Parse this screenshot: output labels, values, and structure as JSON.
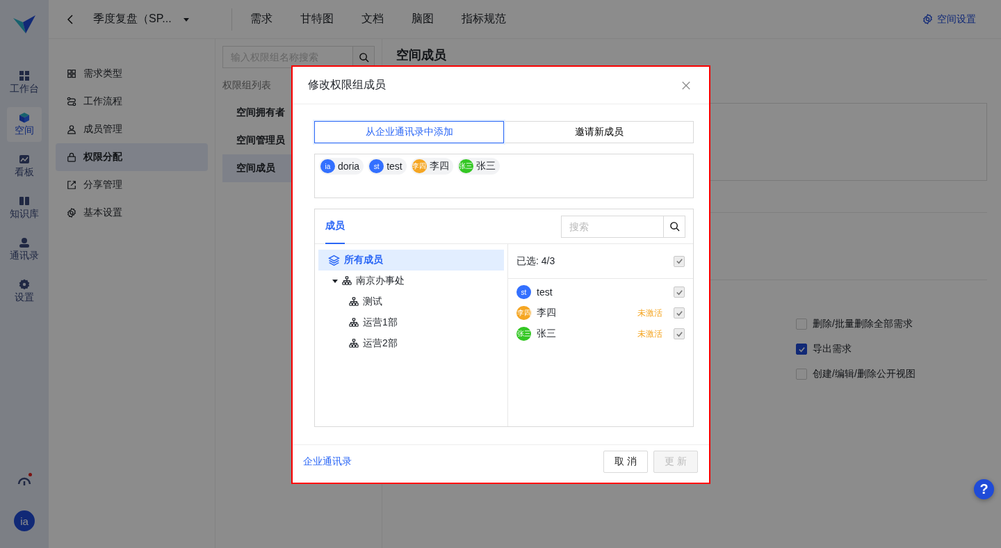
{
  "rail": {
    "items": [
      {
        "label": "工作台",
        "selected": false
      },
      {
        "label": "空间",
        "selected": true
      },
      {
        "label": "看板",
        "selected": false
      },
      {
        "label": "知识库",
        "selected": false
      },
      {
        "label": "通讯录",
        "selected": false
      },
      {
        "label": "设置",
        "selected": false
      }
    ],
    "notification_dot": true,
    "avatar": "ia"
  },
  "topbar": {
    "project": "季度复盘（SP...",
    "nav": [
      "需求",
      "甘特图",
      "文档",
      "脑图",
      "指标规范"
    ],
    "settings": "空间设置"
  },
  "settings_nav": [
    {
      "label": "需求类型",
      "selected": false
    },
    {
      "label": "工作流程",
      "selected": false
    },
    {
      "label": "成员管理",
      "selected": false
    },
    {
      "label": "权限分配",
      "selected": true
    },
    {
      "label": "分享管理",
      "selected": false
    },
    {
      "label": "基本设置",
      "selected": false
    }
  ],
  "groups": {
    "search": {
      "placeholder": "输入权限组名称搜索"
    },
    "title": "权限组列表",
    "items": [
      {
        "label": "空间拥有者",
        "selected": false
      },
      {
        "label": "空间管理员",
        "selected": false
      },
      {
        "label": "空间成员",
        "selected": true
      }
    ]
  },
  "content": {
    "heading": "空间成员",
    "permissions": [
      {
        "label": "删除/批量删除全部需求",
        "checked": false
      },
      {
        "label": "导出需求",
        "checked": true
      },
      {
        "label": "创建/编辑/删除公开视图",
        "checked": false
      }
    ]
  },
  "help": "?",
  "dialog": {
    "title": "修改权限组成员",
    "mode_tabs": [
      {
        "label": "从企业通讯录中添加",
        "selected": true
      },
      {
        "label": "邀请新成员",
        "selected": false
      }
    ],
    "tags": [
      {
        "initials": "ia",
        "name": "doria",
        "color": "#3370ff"
      },
      {
        "initials": "st",
        "name": "test",
        "color": "#3370ff"
      },
      {
        "initials": "李四",
        "name": "李四",
        "color": "#f5a623"
      },
      {
        "initials": "张三",
        "name": "张三",
        "color": "#34c724"
      }
    ],
    "picker": {
      "tabs": [
        {
          "label": "成员",
          "selected": true
        }
      ],
      "search": {
        "placeholder": "搜索"
      },
      "tree": [
        {
          "kind": "all",
          "label": "所有成员",
          "selected": true
        },
        {
          "kind": "department",
          "label": "南京办事处",
          "selected": false,
          "expanded": true,
          "children": [
            {
              "kind": "department",
              "label": "测试",
              "selected": false
            },
            {
              "kind": "department",
              "label": "运营1部",
              "selected": false
            },
            {
              "kind": "department",
              "label": "运营2部",
              "selected": false
            }
          ]
        }
      ],
      "summary": "已选: 4/3",
      "all_checked": true,
      "all_disabled": true,
      "members": [
        {
          "initials": "st",
          "name": "test",
          "color": "#3370ff",
          "checked": true,
          "disabled": true
        },
        {
          "initials": "李四",
          "name": "李四",
          "color": "#f5a623",
          "status": "未激活",
          "checked": true,
          "disabled": true
        },
        {
          "initials": "张三",
          "name": "张三",
          "color": "#34c724",
          "status": "未激活",
          "checked": true,
          "disabled": true
        }
      ]
    },
    "footer_link": "企业通讯录",
    "buttons": [
      {
        "label": "取 消",
        "disabled": false
      },
      {
        "label": "更 新",
        "disabled": true
      }
    ]
  }
}
